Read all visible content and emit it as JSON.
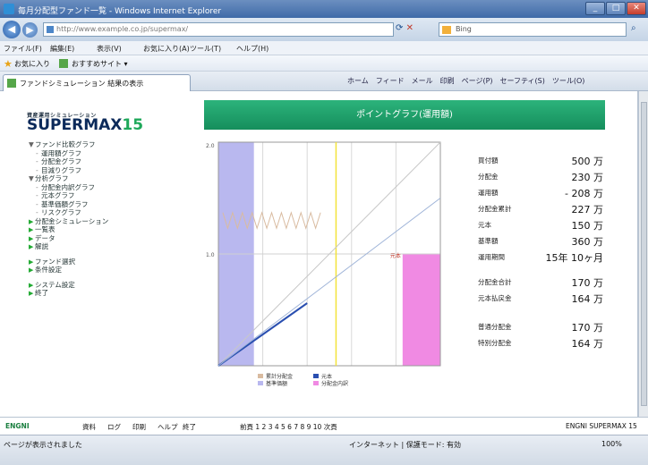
{
  "window": {
    "title": "毎月分配型ファンド一覧 - Windows Internet Explorer"
  },
  "address": {
    "url": "http://www.example.co.jp/supermax/",
    "search_provider": "Bing"
  },
  "menubar": [
    "ファイル(F)",
    "編集(E)",
    "表示(V)",
    "お気に入り(A)",
    "ツール(T)",
    "ヘルプ(H)"
  ],
  "favorites": {
    "label": "お気に入り",
    "link": "おすすめサイト ▾"
  },
  "tab": {
    "title": "ファンドシミュレーション 結果の表示"
  },
  "commands": [
    "ホーム",
    "フィード",
    "メール",
    "印刷",
    "ページ(P)",
    "セーフティ(S)",
    "ツール(O)"
  ],
  "sidebar": {
    "logo_sub": "資産運用シミュレーション",
    "logo_main": "SUPERMAX",
    "logo_num": "15",
    "items": [
      {
        "level": 1,
        "marker": "tri",
        "label": "ファンド比較グラフ"
      },
      {
        "level": 2,
        "marker": "sub",
        "label": "運用額グラフ"
      },
      {
        "level": 2,
        "marker": "sub",
        "label": "分配金グラフ"
      },
      {
        "level": 2,
        "marker": "sub",
        "label": "目減りグラフ"
      },
      {
        "level": 1,
        "marker": "tri",
        "label": "分析グラフ"
      },
      {
        "level": 2,
        "marker": "sub",
        "label": "分配金内訳グラフ"
      },
      {
        "level": 2,
        "marker": "sub",
        "label": "元本グラフ"
      },
      {
        "level": 2,
        "marker": "sub",
        "label": "基準価額グラフ"
      },
      {
        "level": 2,
        "marker": "sub",
        "label": "リスクグラフ"
      },
      {
        "level": 1,
        "marker": "arr",
        "label": "分配金シミュレーション"
      },
      {
        "level": 1,
        "marker": "arr",
        "label": "一覧表"
      },
      {
        "level": 1,
        "marker": "arr",
        "label": "データ"
      },
      {
        "level": 1,
        "marker": "arr",
        "label": "解説"
      },
      {
        "gap": true
      },
      {
        "level": 1,
        "marker": "arr",
        "label": "ファンド選択"
      },
      {
        "level": 1,
        "marker": "arr",
        "label": "条件設定"
      },
      {
        "gap": true
      },
      {
        "level": 1,
        "marker": "arr",
        "label": "システム設定"
      },
      {
        "level": 1,
        "marker": "arr",
        "label": "終了"
      }
    ]
  },
  "panel": {
    "title": "ポイントグラフ(運用額)"
  },
  "chart_data": {
    "type": "line",
    "x": [
      0,
      1,
      2,
      3,
      4,
      5,
      6,
      7,
      8,
      9,
      10
    ],
    "ylim": [
      0,
      2
    ],
    "xlim": [
      0,
      10
    ],
    "tick_labels_y": [
      "1.0",
      "2.0"
    ],
    "annotation": "元本",
    "series": [
      {
        "name": "累計分配金",
        "color": "#c8c8c8",
        "values": [
          0,
          0.2,
          0.4,
          0.6,
          0.8,
          1.0,
          1.2,
          1.4,
          1.6,
          1.8,
          2.0
        ]
      },
      {
        "name": "元本",
        "color": "#2a4fb0",
        "values": [
          0,
          0.14,
          0.28,
          0.42,
          0.56
        ]
      },
      {
        "name": "基準価額",
        "color": "#9fb4d8",
        "values": [
          0,
          0.15,
          0.3,
          0.45,
          0.6,
          0.75,
          0.9,
          1.05,
          1.2,
          1.35,
          1.5
        ]
      },
      {
        "name": "分配金",
        "color": "#d9bba0",
        "values": [
          1.3,
          1.3,
          1.3,
          1.3,
          1.3
        ]
      }
    ],
    "legend": [
      "累計分配金",
      "元本",
      "基準価額",
      "分配金内訳"
    ]
  },
  "stats": [
    {
      "label": "買付額",
      "value": "500 万"
    },
    {
      "label": "分配金",
      "value": "230 万"
    },
    {
      "label": "運用額",
      "value": "- 208 万"
    },
    {
      "label": "分配金累計",
      "value": "227 万"
    },
    {
      "label": "元本",
      "value": "150 万"
    },
    {
      "label": "基準額",
      "value": "360 万"
    },
    {
      "label": "運用期間",
      "value": "15年 10ヶ月"
    },
    {
      "label": "分配金合計",
      "value": "170 万"
    },
    {
      "label": "元本払戻金",
      "value": "164 万"
    },
    {
      "label": "普通分配金",
      "value": "170 万"
    },
    {
      "label": "特別分配金",
      "value": "164 万"
    }
  ],
  "footer": {
    "brand": "ENGNI",
    "items": [
      "資料",
      "ログ",
      "印刷",
      "ヘルプ",
      "終了"
    ],
    "pager": "前頁 1 2 3 4 5 6 7 8 9 10 次頁",
    "right": "ENGNI SUPERMAX 15"
  },
  "ie_status": {
    "left": "ページが表示されました",
    "zone": "インターネット | 保護モード: 有効",
    "zoom": "100%"
  }
}
